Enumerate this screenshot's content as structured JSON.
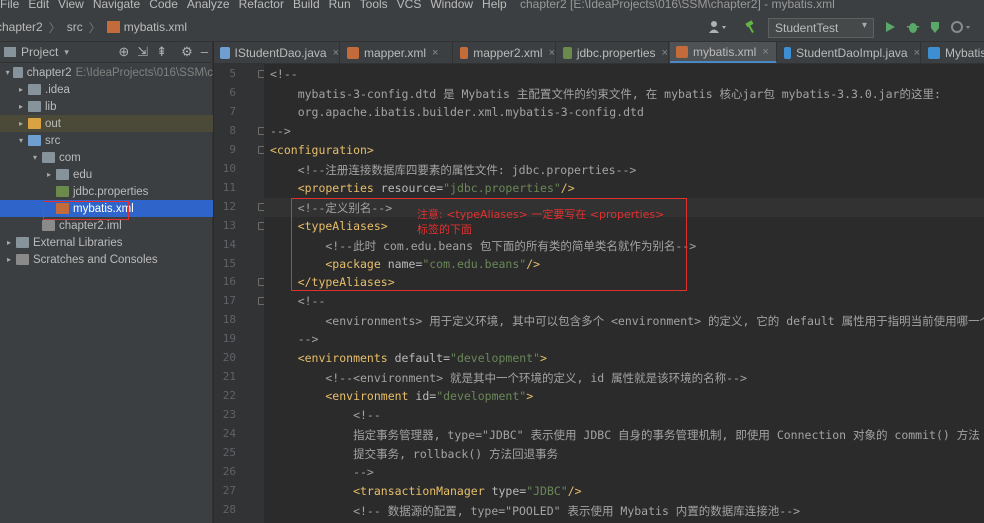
{
  "window": {
    "title": "chapter2 [E:\\IdeaProjects\\016\\SSM\\chapter2] - mybatis.xml",
    "menu": [
      "File",
      "Edit",
      "View",
      "Navigate",
      "Code",
      "Analyze",
      "Refactor",
      "Build",
      "Run",
      "Tools",
      "VCS",
      "Window",
      "Help"
    ]
  },
  "breadcrumb": [
    "chapter2",
    "src",
    "mybatis.xml"
  ],
  "run_config": "StudentTest",
  "project_panel": {
    "title": "Project",
    "tree": [
      {
        "label": "chapter2",
        "path": "E:\\IdeaProjects\\016\\SSM\\c",
        "chev": "▾",
        "icon": "folder"
      },
      {
        "label": ".idea",
        "chev": "▸",
        "icon": "folder"
      },
      {
        "label": "lib",
        "chev": "▸",
        "icon": "folder"
      },
      {
        "label": "out",
        "chev": "▸",
        "icon": "folder-orange"
      },
      {
        "label": "src",
        "chev": "▾",
        "icon": "folder-blue"
      },
      {
        "label": "com",
        "chev": "▾",
        "icon": "folder"
      },
      {
        "label": "edu",
        "chev": "▸",
        "icon": "folder"
      },
      {
        "label": "jdbc.properties",
        "chev": "",
        "icon": "properties-file"
      },
      {
        "label": "mybatis.xml",
        "chev": "",
        "icon": "xml-file"
      },
      {
        "label": "chapter2.iml",
        "chev": "",
        "icon": "iml-file"
      },
      {
        "label": "External Libraries",
        "chev": "▸",
        "icon": "library"
      },
      {
        "label": "Scratches and Consoles",
        "chev": "▸",
        "icon": "scratches"
      }
    ]
  },
  "tabs": [
    {
      "label": "IStudentDao.java",
      "icon": "interface-icon",
      "color": "#6f9fd1"
    },
    {
      "label": "mapper.xml",
      "icon": "xml-icon",
      "color": "#c46b3c"
    },
    {
      "label": "mapper2.xml",
      "icon": "xml-icon",
      "color": "#c46b3c"
    },
    {
      "label": "jdbc.properties",
      "icon": "properties-icon",
      "color": "#6b8a4c"
    },
    {
      "label": "mybatis.xml",
      "icon": "xml-icon",
      "color": "#c46b3c",
      "active": true
    },
    {
      "label": "StudentDaoImpl.java",
      "icon": "class-icon",
      "color": "#3d8fd1"
    },
    {
      "label": "MybatisU",
      "icon": "class-icon",
      "color": "#3d8fd1"
    }
  ],
  "editor": {
    "current_line": 12,
    "lines": [
      {
        "n": 5,
        "parts": [
          {
            "t": "<!--",
            "c": "comment"
          }
        ]
      },
      {
        "n": 6,
        "parts": [
          {
            "t": "    mybatis-3-config.dtd 是 Mybatis 主配置文件的约束文件, 在 mybatis 核心jar包 mybatis-3.3.0.jar的这里:",
            "c": "comment"
          }
        ]
      },
      {
        "n": 7,
        "parts": [
          {
            "t": "    org.apache.ibatis.builder.xml.mybatis-3-config.dtd",
            "c": "comment"
          }
        ]
      },
      {
        "n": 8,
        "parts": [
          {
            "t": "-->",
            "c": "comment"
          }
        ]
      },
      {
        "n": 9,
        "parts": [
          {
            "t": "<configuration>",
            "c": "tag"
          }
        ]
      },
      {
        "n": 10,
        "parts": [
          {
            "t": "    <!--注册连接数据库四要素的属性文件: jdbc.properties-->",
            "c": "comment"
          }
        ]
      },
      {
        "n": 11,
        "parts": [
          {
            "t": "    <properties ",
            "c": "tag"
          },
          {
            "t": "resource=",
            "c": "attr"
          },
          {
            "t": "\"jdbc.properties\"",
            "c": "str"
          },
          {
            "t": "/>",
            "c": "tag"
          }
        ]
      },
      {
        "n": 12,
        "parts": [
          {
            "t": "    <!--定义别名-->",
            "c": "comment"
          }
        ]
      },
      {
        "n": 13,
        "parts": [
          {
            "t": "    <typeAliases>",
            "c": "tag"
          }
        ]
      },
      {
        "n": 14,
        "parts": [
          {
            "t": "        <!--此时 com.edu.beans 包下面的所有类的简单类名就作为别名-->",
            "c": "comment"
          }
        ]
      },
      {
        "n": 15,
        "parts": [
          {
            "t": "        <package ",
            "c": "tag"
          },
          {
            "t": "name=",
            "c": "attr"
          },
          {
            "t": "\"com.edu.beans\"",
            "c": "str"
          },
          {
            "t": "/>",
            "c": "tag"
          }
        ]
      },
      {
        "n": 16,
        "parts": [
          {
            "t": "    </typeAliases>",
            "c": "tag"
          }
        ]
      },
      {
        "n": 17,
        "parts": [
          {
            "t": "    <!--",
            "c": "comment"
          }
        ]
      },
      {
        "n": 18,
        "parts": [
          {
            "t": "        <environments> 用于定义环境, 其中可以包含多个 <environment> 的定义, 它的 default 属性用于指明当前使用哪一个环境",
            "c": "comment"
          }
        ]
      },
      {
        "n": 19,
        "parts": [
          {
            "t": "    -->",
            "c": "comment"
          }
        ]
      },
      {
        "n": 20,
        "parts": [
          {
            "t": "    <environments ",
            "c": "tag"
          },
          {
            "t": "default=",
            "c": "attr"
          },
          {
            "t": "\"development\"",
            "c": "str"
          },
          {
            "t": ">",
            "c": "tag"
          }
        ]
      },
      {
        "n": 21,
        "parts": [
          {
            "t": "        <!--<environment> 就是其中一个环境的定义, id 属性就是该环境的名称-->",
            "c": "comment"
          }
        ]
      },
      {
        "n": 22,
        "parts": [
          {
            "t": "        <environment ",
            "c": "tag"
          },
          {
            "t": "id=",
            "c": "attr"
          },
          {
            "t": "\"development\"",
            "c": "str"
          },
          {
            "t": ">",
            "c": "tag"
          }
        ]
      },
      {
        "n": 23,
        "parts": [
          {
            "t": "            <!--",
            "c": "comment"
          }
        ]
      },
      {
        "n": 24,
        "parts": [
          {
            "t": "            指定事务管理器, type=\"JDBC\" 表示使用 JDBC 自身的事务管理机制, 即使用 Connection 对象的 commit() 方法",
            "c": "comment"
          }
        ]
      },
      {
        "n": 25,
        "parts": [
          {
            "t": "            提交事务, rollback() 方法回退事务",
            "c": "comment"
          }
        ]
      },
      {
        "n": 26,
        "parts": [
          {
            "t": "            -->",
            "c": "comment"
          }
        ]
      },
      {
        "n": 27,
        "parts": [
          {
            "t": "            <transactionManager ",
            "c": "tag"
          },
          {
            "t": "type=",
            "c": "attr"
          },
          {
            "t": "\"JDBC\"",
            "c": "str"
          },
          {
            "t": "/>",
            "c": "tag"
          }
        ]
      },
      {
        "n": 28,
        "parts": [
          {
            "t": "            <!-- 数据源的配置, type=\"POOLED\" 表示使用 Mybatis 内置的数据库连接池-->",
            "c": "comment"
          }
        ]
      }
    ]
  },
  "annotation": {
    "text": "注意: <typeAliases> 一定要写在 <properties> 标签的下面",
    "color": "#e0312f"
  },
  "colors": {
    "comment": "#a3a3a3",
    "tag": "#e8bf6a",
    "attr": "#bababa",
    "string": "#6a8759",
    "selection": "#2f65ca",
    "tab_underline": "#4a88c7"
  }
}
